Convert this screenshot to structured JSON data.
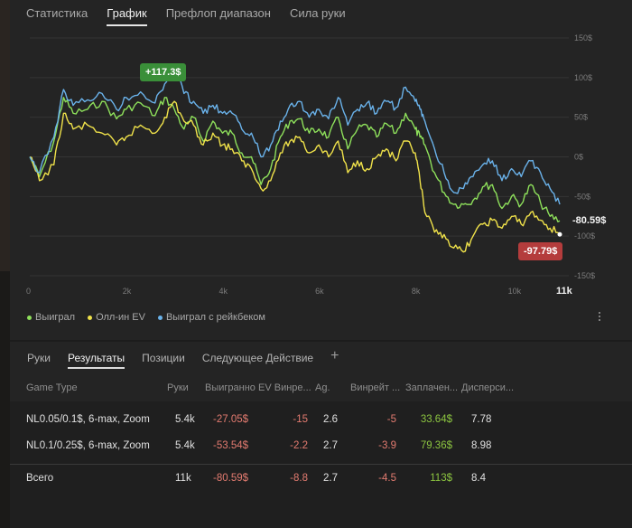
{
  "top_tabs": [
    {
      "label": "Статистика",
      "active": false
    },
    {
      "label": "График",
      "active": true
    },
    {
      "label": "Префлоп диапазон",
      "active": false
    },
    {
      "label": "Сила руки",
      "active": false
    }
  ],
  "chart_data": {
    "type": "line",
    "y_ticks": [
      "150$",
      "100$",
      "50$",
      "0$",
      "-50$",
      "-100$",
      "-150$"
    ],
    "y_values": [
      150,
      100,
      50,
      0,
      -50,
      -100,
      -150
    ],
    "ylim": [
      -150,
      150
    ],
    "x_ticks": [
      "0",
      "2k",
      "4k",
      "6k",
      "8k",
      "10k"
    ],
    "x_values": [
      0,
      2000,
      4000,
      6000,
      8000,
      10000
    ],
    "x_max_label": "11k",
    "xlim": [
      0,
      11000
    ],
    "max_badge": "+117.3$",
    "end_value_label": "-80.59$",
    "min_badge": "-97.79$",
    "series": [
      {
        "name": "Выиграл",
        "color": "#8ee05b",
        "x": [
          0,
          200,
          500,
          700,
          900,
          1200,
          1500,
          1800,
          2000,
          2300,
          2600,
          2800,
          3000,
          3200,
          3400,
          3600,
          3800,
          4000,
          4200,
          4400,
          4600,
          4800,
          5000,
          5200,
          5400,
          5600,
          5800,
          6000,
          6200,
          6400,
          6600,
          6800,
          7000,
          7200,
          7400,
          7600,
          7800,
          8000,
          8100,
          8200,
          8400,
          8600,
          8800,
          9000,
          9200,
          9400,
          9600,
          9800,
          10000,
          10200,
          10400,
          10600,
          10800,
          11000
        ],
        "y": [
          0,
          -25,
          20,
          75,
          55,
          60,
          70,
          48,
          60,
          68,
          52,
          75,
          60,
          35,
          50,
          20,
          45,
          30,
          30,
          5,
          0,
          -35,
          -15,
          25,
          45,
          48,
          30,
          35,
          25,
          50,
          10,
          35,
          40,
          25,
          42,
          30,
          55,
          35,
          25,
          15,
          -20,
          -45,
          -60,
          -60,
          -55,
          -38,
          -35,
          -65,
          -50,
          -60,
          -35,
          -58,
          -75,
          -80.59
        ]
      },
      {
        "name": "Олл-ин EV",
        "color": "#f0e24a",
        "x": [
          0,
          200,
          500,
          700,
          900,
          1200,
          1500,
          1800,
          2000,
          2300,
          2600,
          2800,
          3000,
          3200,
          3400,
          3600,
          3800,
          4000,
          4200,
          4400,
          4600,
          4800,
          5000,
          5200,
          5400,
          5600,
          5800,
          6000,
          6200,
          6400,
          6600,
          6800,
          7000,
          7200,
          7400,
          7600,
          7800,
          8000,
          8100,
          8200,
          8400,
          8600,
          8800,
          9000,
          9200,
          9400,
          9600,
          9800,
          10000,
          10200,
          10400,
          10600,
          10800,
          11000
        ],
        "y": [
          0,
          -30,
          -10,
          55,
          35,
          40,
          30,
          15,
          25,
          40,
          30,
          50,
          70,
          45,
          40,
          15,
          30,
          15,
          10,
          -5,
          -15,
          -40,
          -30,
          5,
          20,
          25,
          5,
          15,
          0,
          20,
          -20,
          -5,
          -15,
          0,
          10,
          -5,
          20,
          5,
          -30,
          -70,
          -95,
          -98,
          -115,
          -120,
          -100,
          -85,
          -80,
          -90,
          -75,
          -85,
          -70,
          -80,
          -90,
          -97.79
        ]
      },
      {
        "name": "Выиграл с рейкбеком",
        "color": "#6ab2ea",
        "x": [
          0,
          200,
          500,
          700,
          900,
          1200,
          1500,
          1800,
          2000,
          2300,
          2600,
          2800,
          3000,
          3200,
          3400,
          3600,
          3800,
          4000,
          4200,
          4400,
          4600,
          4800,
          5000,
          5200,
          5400,
          5600,
          5800,
          6000,
          6200,
          6400,
          6600,
          6800,
          7000,
          7200,
          7400,
          7600,
          7800,
          8000,
          8100,
          8200,
          8400,
          8600,
          8800,
          9000,
          9200,
          9400,
          9600,
          9800,
          10000,
          10200,
          10400,
          10600,
          10800,
          11000
        ],
        "y": [
          0,
          -20,
          25,
          85,
          65,
          72,
          80,
          60,
          75,
          82,
          68,
          92,
          115,
          80,
          70,
          55,
          65,
          55,
          55,
          35,
          30,
          0,
          15,
          45,
          65,
          70,
          50,
          60,
          48,
          75,
          40,
          60,
          68,
          55,
          70,
          62,
          88,
          70,
          60,
          45,
          10,
          -20,
          -45,
          -40,
          -25,
          -10,
          -5,
          -30,
          -15,
          -25,
          -5,
          -20,
          -40,
          -60
        ]
      }
    ]
  },
  "legend": [
    {
      "label": "Выиграл",
      "color": "#8ee05b"
    },
    {
      "label": "Олл-ин EV",
      "color": "#f0e24a"
    },
    {
      "label": "Выиграл с рейкбеком",
      "color": "#6ab2ea"
    }
  ],
  "bottom_tabs": [
    {
      "label": "Руки",
      "active": false
    },
    {
      "label": "Результаты",
      "active": true
    },
    {
      "label": "Позиции",
      "active": false
    },
    {
      "label": "Следующее Действие",
      "active": false
    }
  ],
  "add_tab_icon": "plus-icon",
  "table": {
    "headers": [
      "Game Type",
      "Руки",
      "Выигранно",
      "EV Винре...",
      "Ag.",
      "Винрейт ...",
      "Заплачен...",
      "Дисперси..."
    ],
    "rows": [
      [
        "NL0.05/0.1$, 6-max, Zoom",
        "5.4k",
        "-27.05$",
        "-15",
        "2.6",
        "-5",
        "33.64$",
        "7.78"
      ],
      [
        "NL0.1/0.25$, 6-max, Zoom",
        "5.4k",
        "-53.54$",
        "-2.2",
        "2.7",
        "-3.9",
        "79.36$",
        "8.98"
      ]
    ],
    "total": [
      "Всего",
      "11k",
      "-80.59$",
      "-8.8",
      "2.7",
      "-4.5",
      "113$",
      "8.4"
    ]
  },
  "colors": {
    "negative": "#e37b70",
    "positive": "#8cc540",
    "accent_green": "#3a8f39",
    "accent_red": "#b43c3c"
  }
}
